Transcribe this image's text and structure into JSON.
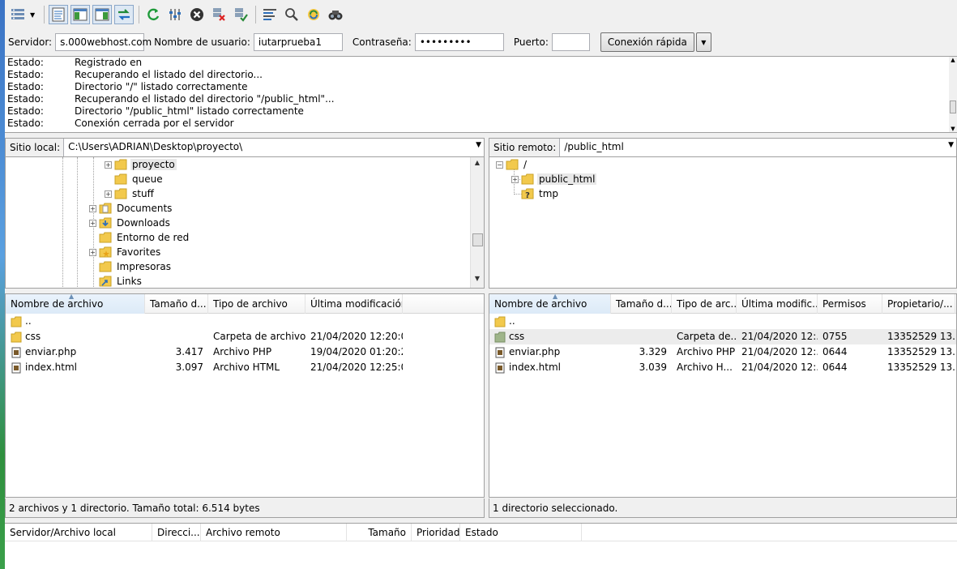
{
  "toolbar": {
    "icons": [
      "site-manager-icon",
      "dropdown-arrow-icon",
      "toggle-log-icon",
      "toggle-local-tree-icon",
      "toggle-remote-tree-icon",
      "toggle-queue-icon",
      "refresh-icon",
      "process-queue-icon",
      "cancel-icon",
      "disconnect-icon",
      "reconnect-icon",
      "filter-icon",
      "compare-icon",
      "sync-browse-icon",
      "search-icon"
    ]
  },
  "quickconnect": {
    "host_label": "Servidor:",
    "host_value": "s.000webhost.com",
    "user_label": "Nombre de usuario:",
    "user_value": "iutarprueba1",
    "pass_label": "Contraseña:",
    "pass_value": "•••••••••",
    "port_label": "Puerto:",
    "port_value": "",
    "connect_label": "Conexión rápida"
  },
  "log": [
    {
      "k": "Estado:",
      "v": "Registrado en"
    },
    {
      "k": "Estado:",
      "v": "Recuperando el listado del directorio..."
    },
    {
      "k": "Estado:",
      "v": "Directorio \"/\" listado correctamente"
    },
    {
      "k": "Estado:",
      "v": "Recuperando el listado del directorio \"/public_html\"..."
    },
    {
      "k": "Estado:",
      "v": "Directorio \"/public_html\" listado correctamente"
    },
    {
      "k": "Estado:",
      "v": "Conexión cerrada por el servidor"
    }
  ],
  "local": {
    "site_label": "Sitio local:",
    "path": "C:\\Users\\ADRIAN\\Desktop\\proyecto\\",
    "tree": [
      {
        "label": "proyecto"
      },
      {
        "label": "queue"
      },
      {
        "label": "stuff"
      },
      {
        "label": "Documents"
      },
      {
        "label": "Downloads"
      },
      {
        "label": "Entorno de red"
      },
      {
        "label": "Favorites"
      },
      {
        "label": "Impresoras"
      },
      {
        "label": "Links"
      }
    ],
    "columns": [
      "Nombre de archivo",
      "Tamaño d...",
      "Tipo de archivo",
      "Última modificación"
    ],
    "files": [
      {
        "name": "..",
        "size": "",
        "type": "",
        "modified": ""
      },
      {
        "name": "css",
        "size": "",
        "type": "Carpeta de archivos",
        "modified": "21/04/2020 12:20:0..."
      },
      {
        "name": "enviar.php",
        "size": "3.417",
        "type": "Archivo PHP",
        "modified": "19/04/2020 01:20:2..."
      },
      {
        "name": "index.html",
        "size": "3.097",
        "type": "Archivo HTML",
        "modified": "21/04/2020 12:25:0..."
      }
    ],
    "status": "2 archivos y 1 directorio. Tamaño total: 6.514 bytes"
  },
  "remote": {
    "site_label": "Sitio remoto:",
    "path": "/public_html",
    "tree": [
      {
        "label": "/"
      },
      {
        "label": "public_html"
      },
      {
        "label": "tmp"
      }
    ],
    "columns": [
      "Nombre de archivo",
      "Tamaño d...",
      "Tipo de arc...",
      "Última modific...",
      "Permisos",
      "Propietario/..."
    ],
    "files": [
      {
        "name": "..",
        "size": "",
        "type": "",
        "modified": "",
        "perms": "",
        "owner": ""
      },
      {
        "name": "css",
        "size": "",
        "type": "Carpeta de...",
        "modified": "21/04/2020 12:...",
        "perms": "0755",
        "owner": "13352529 13..."
      },
      {
        "name": "enviar.php",
        "size": "3.329",
        "type": "Archivo PHP",
        "modified": "21/04/2020 12:...",
        "perms": "0644",
        "owner": "13352529 13..."
      },
      {
        "name": "index.html",
        "size": "3.039",
        "type": "Archivo H...",
        "modified": "21/04/2020 12:...",
        "perms": "0644",
        "owner": "13352529 13..."
      }
    ],
    "status": "1 directorio seleccionado."
  },
  "queue": {
    "columns": [
      "Servidor/Archivo local",
      "Direcci...",
      "Archivo remoto",
      "Tamaño",
      "Prioridad",
      "Estado"
    ]
  },
  "colors": {
    "folder": "#f2c94c",
    "selection": "#ececec",
    "border": "#a0a0a0"
  }
}
